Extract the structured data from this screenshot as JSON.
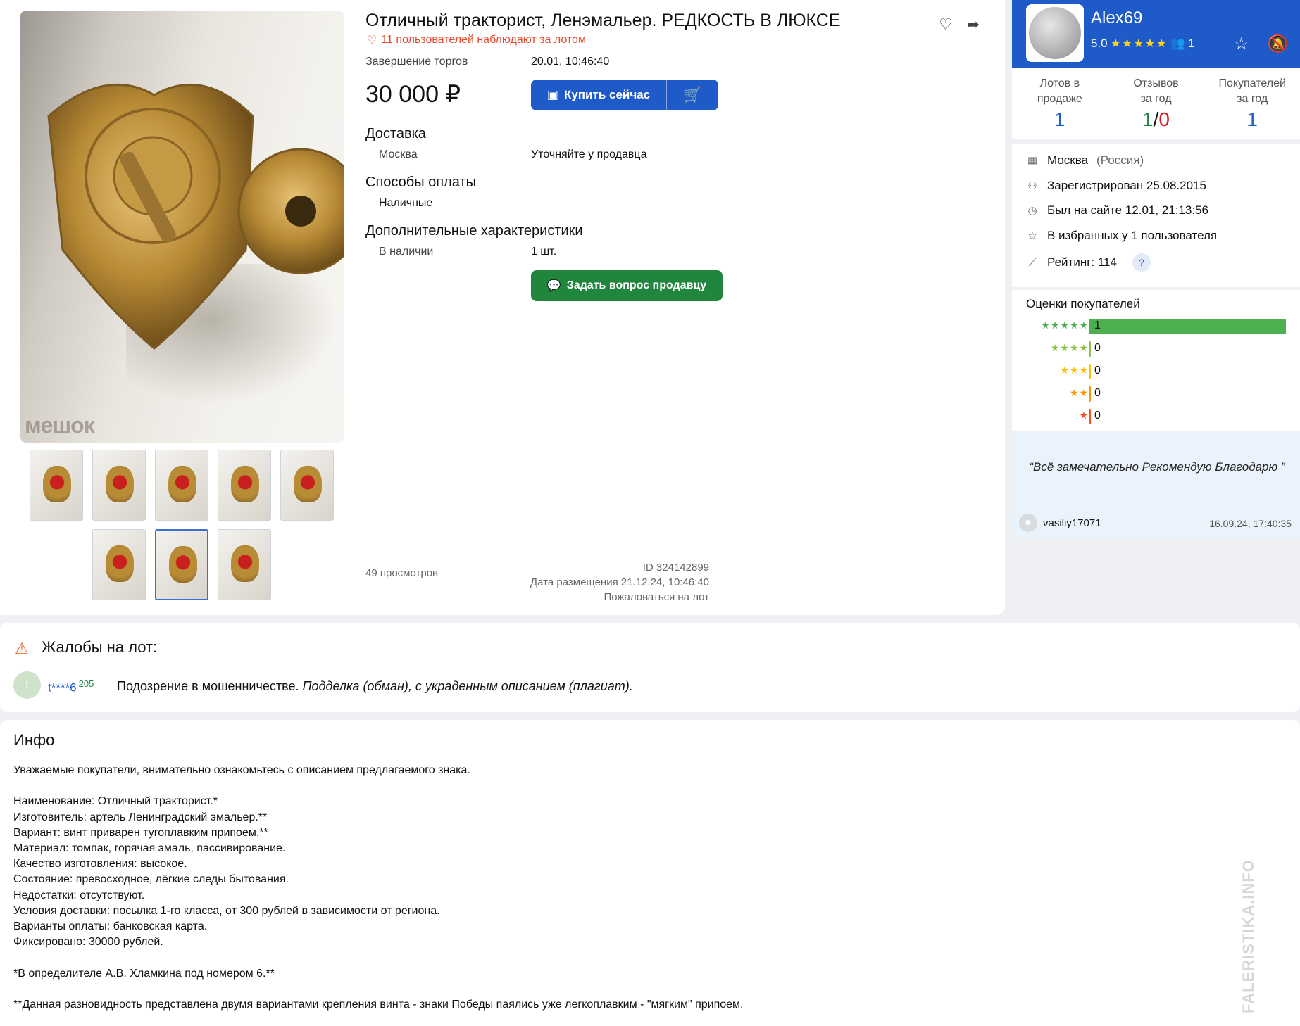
{
  "lot": {
    "title": "Отличный тракторист, Ленэмальер. РЕДКОСТЬ В ЛЮКСЕ",
    "watchers": "11 пользователей наблюдают за лотом",
    "end_label": "Завершение торгов",
    "end_value": "20.01, 10:46:40",
    "price": "30 000 ₽",
    "buy_now_label": "Купить сейчас",
    "delivery_title": "Доставка",
    "delivery_city": "Москва",
    "delivery_value": "Уточняйте у продавца",
    "payment_title": "Способы оплаты",
    "payment_value": "Наличные",
    "extra_title": "Дополнительные характеристики",
    "stock_label": "В наличии",
    "stock_value": "1 шт.",
    "ask_label": "Задать вопрос продавцу",
    "views": "49 просмотров",
    "id": "ID 324142899",
    "posted": "Дата размещения 21.12.24, 10:46:40",
    "report": "Пожаловаться на лот",
    "photo_watermark": "мешок",
    "thumbnails_count": 8,
    "active_thumbnail": 7
  },
  "seller": {
    "name": "Alex69",
    "rating": "5.0",
    "stars": "★★★★★",
    "followers": "1",
    "stats": [
      {
        "label_1": "Лотов в",
        "label_2": "продаже",
        "value": "1"
      },
      {
        "label_1": "Отзывов",
        "label_2": "за год",
        "value_pos": "1",
        "sep": "/",
        "value_neg": "0"
      },
      {
        "label_1": "Покупателей",
        "label_2": "за год",
        "value": "1"
      }
    ],
    "city": "Москва",
    "country": "(Россия)",
    "registered": "Зарегистрирован 25.08.2015",
    "last_seen": "Был на сайте 12.01, 21:13:56",
    "favorites": "В избранных у 1 пользователя",
    "score": "Рейтинг: 114",
    "help": "?"
  },
  "ratings": {
    "title": "Оценки покупателей",
    "rows": [
      {
        "stars": "★★★★★",
        "count": "1",
        "color": "#4caf50",
        "fill": 1.0
      },
      {
        "stars": "★★★★",
        "count": "0",
        "color": "#8bc34a",
        "fill": 0
      },
      {
        "stars": "★★★",
        "count": "0",
        "color": "#ffc107",
        "fill": 0
      },
      {
        "stars": "★★",
        "count": "0",
        "color": "#ff9800",
        "fill": 0
      },
      {
        "stars": "★",
        "count": "0",
        "color": "#f4511e",
        "fill": 0
      }
    ]
  },
  "review": {
    "text": "“Всё замечательно Рекомендую Благодарю ”",
    "user": "vasiliy17071",
    "date": "16.09.24, 17:40:35"
  },
  "complaints": {
    "title": "Жалобы на лот:",
    "avatar_letter": "t",
    "user": "t****6",
    "user_score": "205",
    "reason": "Подозрение в мошенничестве.",
    "details": "Подделка (обман), с украденным описанием (плагиат)."
  },
  "info": {
    "title": "Инфо",
    "lines": [
      "Уважаемые покупатели, внимательно ознакомьтесь с описанием предлагаемого знака.",
      "",
      "Наименование: Отличный тракторист.*",
      "Изготовитель: артель Ленинградский эмальер.**",
      "Вариант: винт приварен тугоплавким припоем.**",
      "Материал: томпак, горячая эмаль, пассивирование.",
      "Качество изготовления: высокое.",
      "Состояние: превосходное, лёгкие следы бытования.",
      "Недостатки: отсутствуют.",
      "Условия доставки: посылка 1-го класса, от 300 рублей в зависимости от региона.",
      "Варианты оплаты: банковская карта.",
      "Фиксировано: 30000 рублей.",
      "",
      "*В определителе А.В. Хламкина под номером 6.**",
      "",
      "**Данная разновидность представлена двумя вариантами крепления винта - знаки Победы паялись уже легкоплавким - \"мягким\" припоем."
    ]
  },
  "side_watermark": "FALERISTIKA.INFO",
  "colors": {
    "brand": "#1f5bc8",
    "buy": "#1f5bc8",
    "ask": "#20853d",
    "watch": "#e84a2f"
  }
}
